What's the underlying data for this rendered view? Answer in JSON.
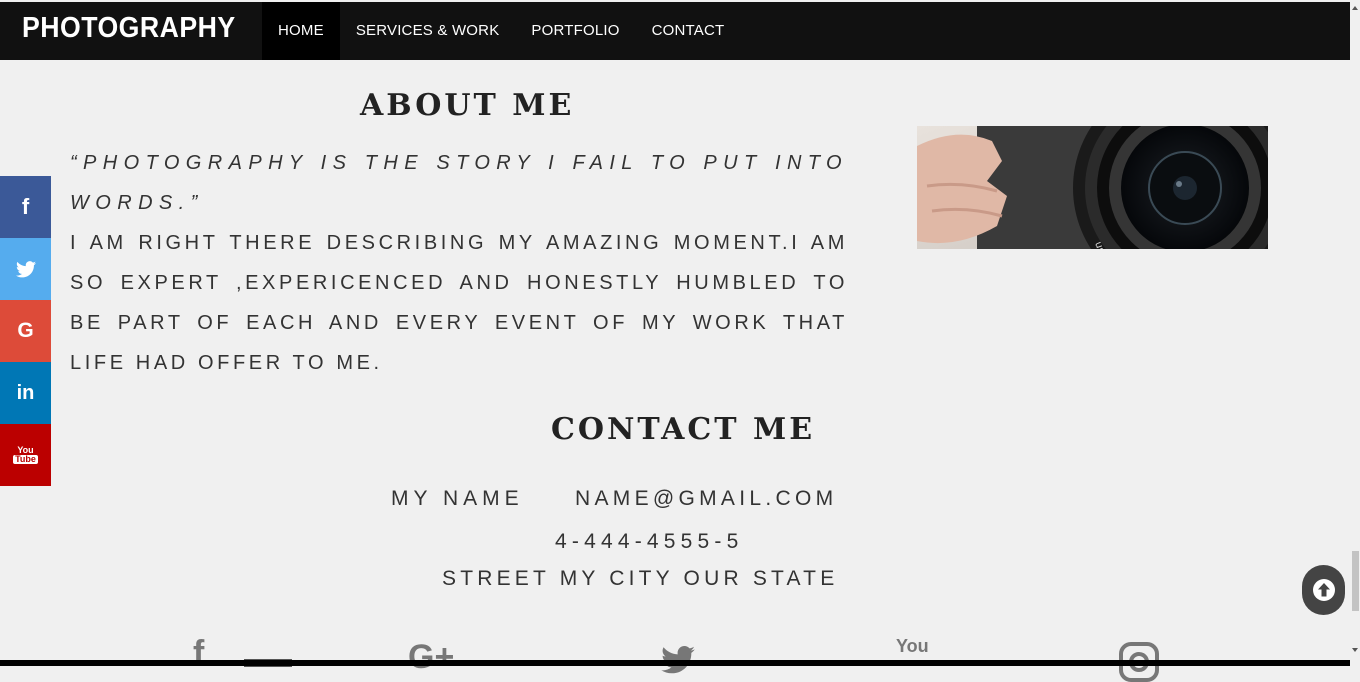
{
  "nav": {
    "brand": "PHOTOGRAPHY",
    "links": [
      {
        "label": "HOME",
        "active": true
      },
      {
        "label": "SERVICES & WORK",
        "active": false
      },
      {
        "label": "PORTFOLIO",
        "active": false
      },
      {
        "label": "CONTACT",
        "active": false
      }
    ]
  },
  "about": {
    "heading": "ABOUT ME",
    "quote": "“Photography is the story I fail to put into words.”",
    "body": "I am right there describing my amazing moment.I am so expert ,expericenced and honestly humbled to be part of each and every event of my work that life had offer to me."
  },
  "contact": {
    "heading": "CONTACT ME",
    "name": "MY NAME",
    "email": "NAME@GMAIL.COM",
    "phone": "4-444-4555-5",
    "address": "STREET MY CITY OUR STATE"
  },
  "social_sidebar": [
    {
      "icon": "facebook-icon",
      "glyph": "f",
      "color": "#3b5998"
    },
    {
      "icon": "twitter-icon",
      "glyph": "",
      "color": "#55acee"
    },
    {
      "icon": "google-plus-icon",
      "glyph": "G",
      "color": "#dd4b39"
    },
    {
      "icon": "linkedin-icon",
      "glyph": "in",
      "color": "#0077b5"
    },
    {
      "icon": "youtube-icon",
      "glyph": "You Tube",
      "color": "#bb0000"
    }
  ],
  "footer_icons": {
    "facebook": "f",
    "google": "G+",
    "youtube": "You"
  },
  "colors": {
    "navbar": "#111111",
    "background": "#f0f0f0"
  }
}
